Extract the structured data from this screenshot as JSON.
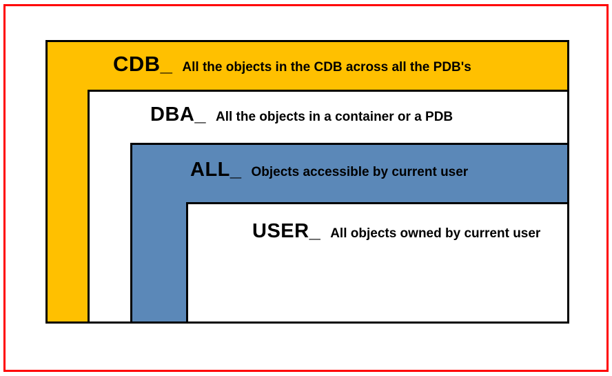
{
  "layers": {
    "cdb": {
      "prefix": "CDB_",
      "description": "All the objects in the CDB across all the PDB's",
      "bg": "#ffc000"
    },
    "dba": {
      "prefix": "DBA_",
      "description": "All the objects in a container or a PDB",
      "bg": "#ffffff"
    },
    "all": {
      "prefix": "ALL_",
      "description": "Objects accessible by current user",
      "bg": "#5b88b8"
    },
    "user": {
      "prefix": "USER_",
      "description": "All objects owned by current user",
      "bg": "#ffffff"
    }
  },
  "colors": {
    "frame_border": "#ff0000",
    "layer_border": "#000000"
  }
}
